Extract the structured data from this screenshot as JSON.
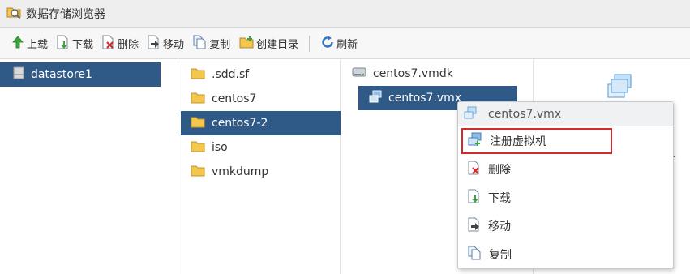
{
  "window": {
    "title": "数据存储浏览器"
  },
  "toolbar": {
    "upload": "上载",
    "download": "下载",
    "delete": "删除",
    "move": "移动",
    "copy": "复制",
    "mkdir": "创建目录",
    "refresh": "刷新"
  },
  "datastores": [
    {
      "name": "datastore1",
      "selected": true
    }
  ],
  "folders": [
    {
      "name": ".sdd.sf",
      "selected": false
    },
    {
      "name": "centos7",
      "selected": false
    },
    {
      "name": "centos7-2",
      "selected": true
    },
    {
      "name": "iso",
      "selected": false
    },
    {
      "name": "vmkdump",
      "selected": false
    }
  ],
  "files": [
    {
      "name": "centos7.vmdk",
      "icon": "disk-icon",
      "selected": false
    },
    {
      "name": "centos7.vmx",
      "icon": "vm-config-icon",
      "selected": true
    }
  ],
  "preview": {
    "icon": "vm-config-icon",
    "trailing": "."
  },
  "context_menu": {
    "header": "centos7.vmx",
    "items": [
      {
        "label": "注册虚拟机",
        "icon": "register-vm-icon",
        "highlighted": true
      },
      {
        "label": "删除",
        "icon": "delete-icon"
      },
      {
        "label": "下载",
        "icon": "download-icon"
      },
      {
        "label": "移动",
        "icon": "move-icon"
      },
      {
        "label": "复制",
        "icon": "copy-icon"
      }
    ]
  },
  "colors": {
    "selection": "#2f5a87",
    "highlight_border": "#d22b2b"
  }
}
